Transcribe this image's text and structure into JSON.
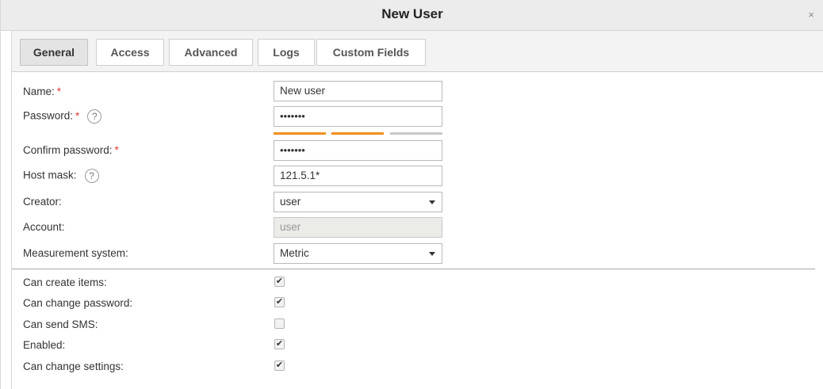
{
  "dialog": {
    "title": "New User",
    "close_label": "×"
  },
  "tabs": [
    {
      "label": "General",
      "active": true
    },
    {
      "label": "Access",
      "active": false
    },
    {
      "label": "Advanced",
      "active": false
    },
    {
      "label": "Logs",
      "active": false
    },
    {
      "label": "Custom Fields",
      "active": false
    }
  ],
  "form": {
    "name": {
      "label": "Name:",
      "required_mark": "*",
      "value": "New user"
    },
    "password": {
      "label": "Password:",
      "required_mark": "*",
      "help": "?",
      "value": "•••••••"
    },
    "password_strength": {
      "segments": 3,
      "filled": 2,
      "colors": {
        "filled": "#f0901e",
        "empty": "#c8c8c8"
      }
    },
    "confirm_password": {
      "label": "Confirm password:",
      "required_mark": "*",
      "value": "•••••••"
    },
    "host_mask": {
      "label": "Host mask:",
      "help": "?",
      "value": "121.5.1*"
    },
    "creator": {
      "label": "Creator:",
      "value": "user"
    },
    "account": {
      "label": "Account:",
      "value": "user"
    },
    "measurement_system": {
      "label": "Measurement system:",
      "value": "Metric"
    }
  },
  "checkboxes": [
    {
      "label": "Can create items:",
      "checked": true
    },
    {
      "label": "Can change password:",
      "checked": true
    },
    {
      "label": "Can send SMS:",
      "checked": false
    },
    {
      "label": "Enabled:",
      "checked": true
    },
    {
      "label": "Can change settings:",
      "checked": true
    }
  ],
  "check_glyph": "✔",
  "icons": {
    "help": "help-circle-icon",
    "close": "close-icon",
    "dropdown": "chevron-down-icon",
    "check": "checkmark-icon"
  },
  "colors": {
    "required": "#e53935",
    "titlebar_bg": "#ececec",
    "tab_active_bg": "#e4e4e4"
  }
}
